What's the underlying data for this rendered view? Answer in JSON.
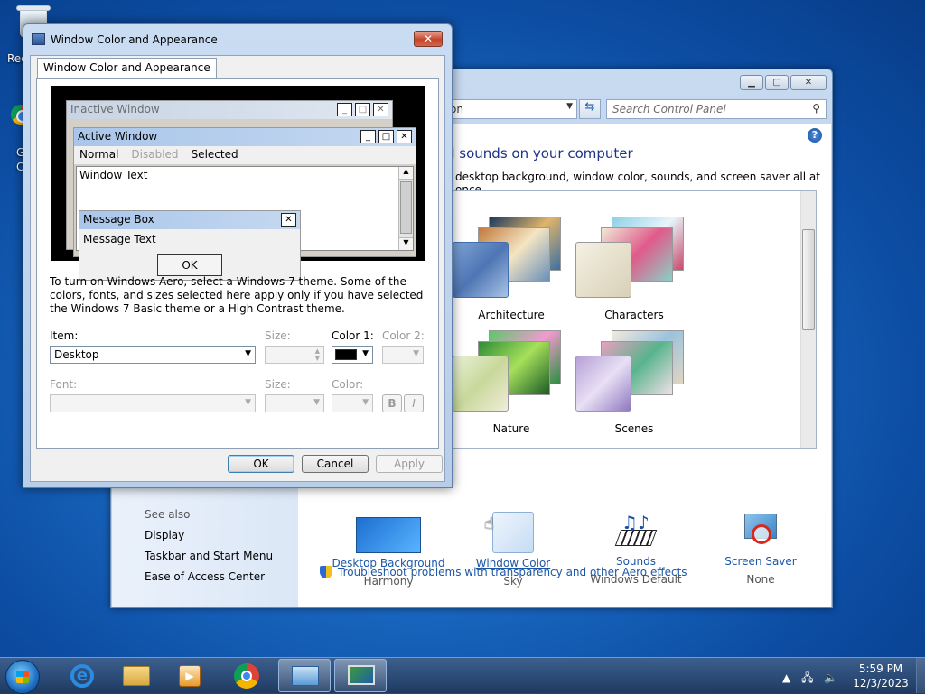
{
  "desktop": {
    "recycle_label": "Rec",
    "chrome_label_1": "G",
    "chrome_label_2": "C"
  },
  "control_panel": {
    "address_text": "on",
    "search_placeholder": "Search Control Panel",
    "heading": "d sounds on your computer",
    "subheading": "desktop background, window color, sounds, and screen saver all at once.",
    "themes": [
      {
        "label": "Architecture"
      },
      {
        "label": "Characters"
      },
      {
        "label": "Nature"
      },
      {
        "label": "Scenes"
      }
    ],
    "bottom_items": [
      {
        "link": "Desktop Background",
        "value": "Harmony"
      },
      {
        "link": "Window Color",
        "value": "Sky"
      },
      {
        "link": "Sounds",
        "value": "Windows Default"
      },
      {
        "link": "Screen Saver",
        "value": "None"
      }
    ],
    "see_also": "See also",
    "side_links": [
      "Display",
      "Taskbar and Start Menu",
      "Ease of Access Center"
    ],
    "troubleshoot": "Troubleshoot problems with transparency and other Aero effects"
  },
  "dialog": {
    "title": "Window Color and Appearance",
    "tab": "Window Color and Appearance",
    "preview": {
      "inactive_title": "Inactive Window",
      "active_title": "Active Window",
      "menu": [
        "Normal",
        "Disabled",
        "Selected"
      ],
      "window_text": "Window Text",
      "msgbox_title": "Message Box",
      "msgbox_text": "Message Text",
      "ok": "OK"
    },
    "description": "To turn on Windows Aero, select a Windows 7 theme.  Some of the colors, fonts, and sizes selected here apply only if you have selected the Windows 7 Basic theme or a High Contrast theme.",
    "item_label": "Item:",
    "item_value": "Desktop",
    "size_label": "Size:",
    "color1_label": "Color 1:",
    "color2_label": "Color 2:",
    "font_label": "Font:",
    "font_size_label": "Size:",
    "font_color_label": "Color:",
    "bold": "B",
    "italic": "I",
    "ok_button": "OK",
    "cancel_button": "Cancel",
    "apply_button": "Apply",
    "color1_swatch": "#000000"
  },
  "taskbar": {
    "time": "5:59 PM",
    "date": "12/3/2023"
  },
  "colors": {
    "link": "#1c57a5",
    "heading": "#1e3287",
    "active_title": "#a9c6ea",
    "inactive_title": "#c8d4e4"
  }
}
